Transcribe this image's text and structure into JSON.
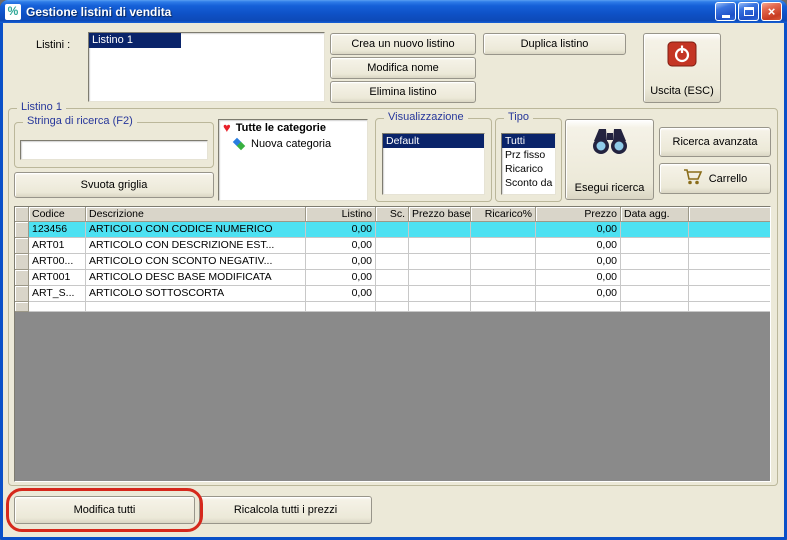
{
  "window": {
    "title": "Gestione listini di vendita"
  },
  "icons": {
    "window": "%",
    "close": "×",
    "heart": "♥"
  },
  "toolbar": {
    "listini_label": "Listini :",
    "listini_items": [
      "Listino 1"
    ],
    "listini_selected": "Listino 1",
    "crea_button": "Crea un nuovo listino",
    "modifica_nome_button": "Modifica nome",
    "elimina_button": "Elimina listino",
    "duplica_button": "Duplica listino",
    "uscita_button": "Uscita (ESC)"
  },
  "listino_group": {
    "title": "Listino 1",
    "ricerca_group_title": "Stringa di ricerca (F2)",
    "search_value": "",
    "svuota_button": "Svuota griglia",
    "categorie": [
      {
        "label": "Tutte le categorie",
        "icon": "heart-icon"
      },
      {
        "label": "Nuova categoria",
        "icon": "category-icon"
      }
    ],
    "visualizzazione": {
      "title": "Visualizzazione",
      "items": [
        "Default"
      ],
      "selected": "Default"
    },
    "tipo": {
      "title": "Tipo",
      "items": [
        "Tutti",
        "Prz fisso",
        "Ricarico",
        "Sconto da listin"
      ],
      "selected": "Tutti"
    },
    "esegui_button": "Esegui ricerca",
    "ricerca_avanzata_button": "Ricerca avanzata",
    "carrello_button": "Carrello"
  },
  "grid": {
    "columns": [
      "Codice",
      "Descrizione",
      "Listino",
      "Sc.",
      "Prezzo base",
      "Ricarico%",
      "Prezzo",
      "Data agg."
    ],
    "rows": [
      {
        "codice": "123456",
        "descrizione": "ARTICOLO CON CODICE NUMERICO",
        "listino": "0,00",
        "sc": "",
        "prezzo_base": "",
        "ricarico": "",
        "prezzo": "0,00",
        "data_agg": "",
        "selected": true
      },
      {
        "codice": "ART01",
        "descrizione": "ARTICOLO CON DESCRIZIONE EST...",
        "listino": "0,00",
        "sc": "",
        "prezzo_base": "",
        "ricarico": "",
        "prezzo": "0,00",
        "data_agg": "",
        "selected": false
      },
      {
        "codice": "ART00...",
        "descrizione": "ARTICOLO CON SCONTO NEGATIV...",
        "listino": "0,00",
        "sc": "",
        "prezzo_base": "",
        "ricarico": "",
        "prezzo": "0,00",
        "data_agg": "",
        "selected": false
      },
      {
        "codice": "ART001",
        "descrizione": "ARTICOLO DESC BASE MODIFICATA",
        "listino": "0,00",
        "sc": "",
        "prezzo_base": "",
        "ricarico": "",
        "prezzo": "0,00",
        "data_agg": "",
        "selected": false
      },
      {
        "codice": "ART_S...",
        "descrizione": "ARTICOLO SOTTOSCORTA",
        "listino": "0,00",
        "sc": "",
        "prezzo_base": "",
        "ricarico": "",
        "prezzo": "0,00",
        "data_agg": "",
        "selected": false
      }
    ]
  },
  "footer": {
    "modifica_tutti_button": "Modifica tutti",
    "ricalcola_button": "Ricalcola tutti i prezzi"
  },
  "colors": {
    "selection_navy": "#0A246A",
    "selection_cyan": "#4DE1F2",
    "annotation_red": "#D5281C",
    "heart_red": "#E8202A",
    "exit_icon_red": "#C43524"
  }
}
